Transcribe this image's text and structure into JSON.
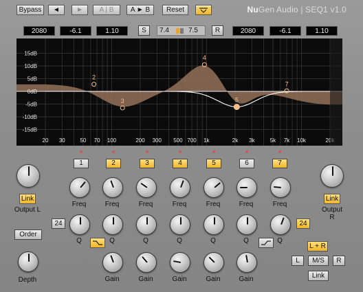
{
  "toolbar": {
    "bypass": "Bypass",
    "undo": "◄",
    "redo": "►",
    "ab_compare": "A | B",
    "ab_copy": "A ► B",
    "reset": "Reset",
    "menu_icon": "dropdown-icon"
  },
  "brand": {
    "company_a": "Nu",
    "company_b": "Gen Audio",
    "product": "| SEQ1 v1.0"
  },
  "displays": {
    "left": {
      "freq": "2080",
      "gain": "-6.1",
      "q": "1.10"
    },
    "right": {
      "freq": "2080",
      "gain": "-6.1",
      "q": "1.10"
    },
    "s_button": "S",
    "r_button": "R",
    "slope_left": "7.4",
    "slope_right": "7.5"
  },
  "graph": {
    "db_ticks": [
      "15dB",
      "10dB",
      "5dB",
      "0dB",
      "-5dB",
      "-10dB",
      "-15dB"
    ],
    "freq_ticks": [
      "20",
      "30",
      "50",
      "70",
      "100",
      "200",
      "300",
      "500",
      "700",
      "1k",
      "2k",
      "3k",
      "5k",
      "7k",
      "10k",
      "20k"
    ],
    "nodes": [
      "2",
      "3",
      "4",
      "5",
      "7"
    ],
    "colors": {
      "fill": "#8a6a54",
      "curve": "#ffffff",
      "bg": "#0b0b0b",
      "grid": "#3a3a3a",
      "node": "#f6c08a"
    }
  },
  "bands": [
    "1",
    "2",
    "3",
    "4",
    "5",
    "6",
    "7"
  ],
  "bands_active": [
    false,
    true,
    true,
    true,
    true,
    false,
    true
  ],
  "labels": {
    "freq": "Freq",
    "q": "Q",
    "gain": "Gain",
    "output_l": "Output L",
    "output_r": "Output R",
    "depth": "Depth",
    "link": "Link",
    "order": "Order",
    "slope_24_left": "24",
    "slope_24_right": "24"
  },
  "stereo": {
    "lr": "L + R",
    "l": "L",
    "ms": "M/S",
    "r": "R",
    "link": "Link"
  }
}
